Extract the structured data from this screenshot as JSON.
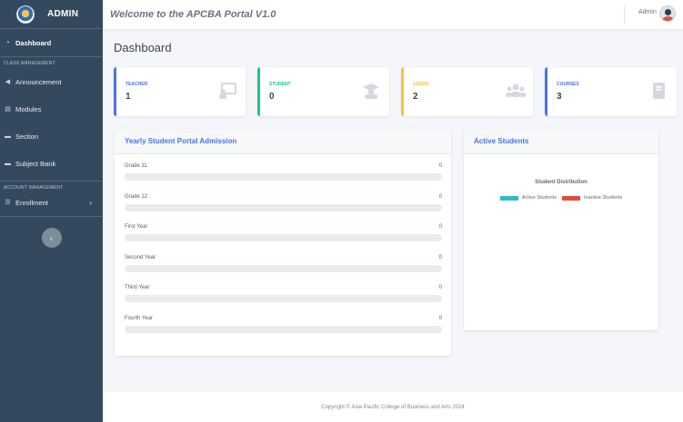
{
  "sidebar": {
    "brand": "ADMIN",
    "dashboard": "Dashboard",
    "class_heading": "CLASS MANAGEMENT",
    "class_items": [
      "Announcement",
      "Modules",
      "Section",
      "Subject Bank"
    ],
    "account_heading": "ACCOUNT MANAGEMENT",
    "enrollment": "Enrollment",
    "toggle_glyph": "‹"
  },
  "topbar": {
    "welcome": "Welcome to the APCBA Portal V1.0",
    "user": "Admin"
  },
  "page": {
    "title": "Dashboard"
  },
  "cards": [
    {
      "label": "TEACHER",
      "value": "1",
      "color": "#4e73df",
      "icon": "chalkboard-teacher-icon"
    },
    {
      "label": "STUDENT",
      "value": "0",
      "color": "#1cc88a",
      "icon": "graduate-icon"
    },
    {
      "label": "USERS",
      "value": "2",
      "color": "#f6c23e",
      "icon": "users-icon"
    },
    {
      "label": "COURSES",
      "value": "3",
      "color": "#4e73df",
      "icon": "book-icon"
    }
  ],
  "admission": {
    "title": "Yearly Student Portal Admission",
    "rows": [
      {
        "label": "Grade 11",
        "count": "0",
        "fill_pct": 0
      },
      {
        "label": "Grade 12",
        "count": "0",
        "fill_pct": 0
      },
      {
        "label": "First Year",
        "count": "0",
        "fill_pct": 0
      },
      {
        "label": "Second Year",
        "count": "0",
        "fill_pct": 0
      },
      {
        "label": "Third Year",
        "count": "0",
        "fill_pct": 0
      },
      {
        "label": "Fourth Year",
        "count": "0",
        "fill_pct": 0
      }
    ]
  },
  "active_students": {
    "title": "Active Students",
    "chart_title": "Student Distribution",
    "legend": [
      {
        "label": "Active Students",
        "color": "#36b9cc"
      },
      {
        "label": "Inactive Students",
        "color": "#e74a3b"
      }
    ]
  },
  "footer": {
    "text": "Copyright © Asia Pacific College of Business and Arts 2024"
  }
}
